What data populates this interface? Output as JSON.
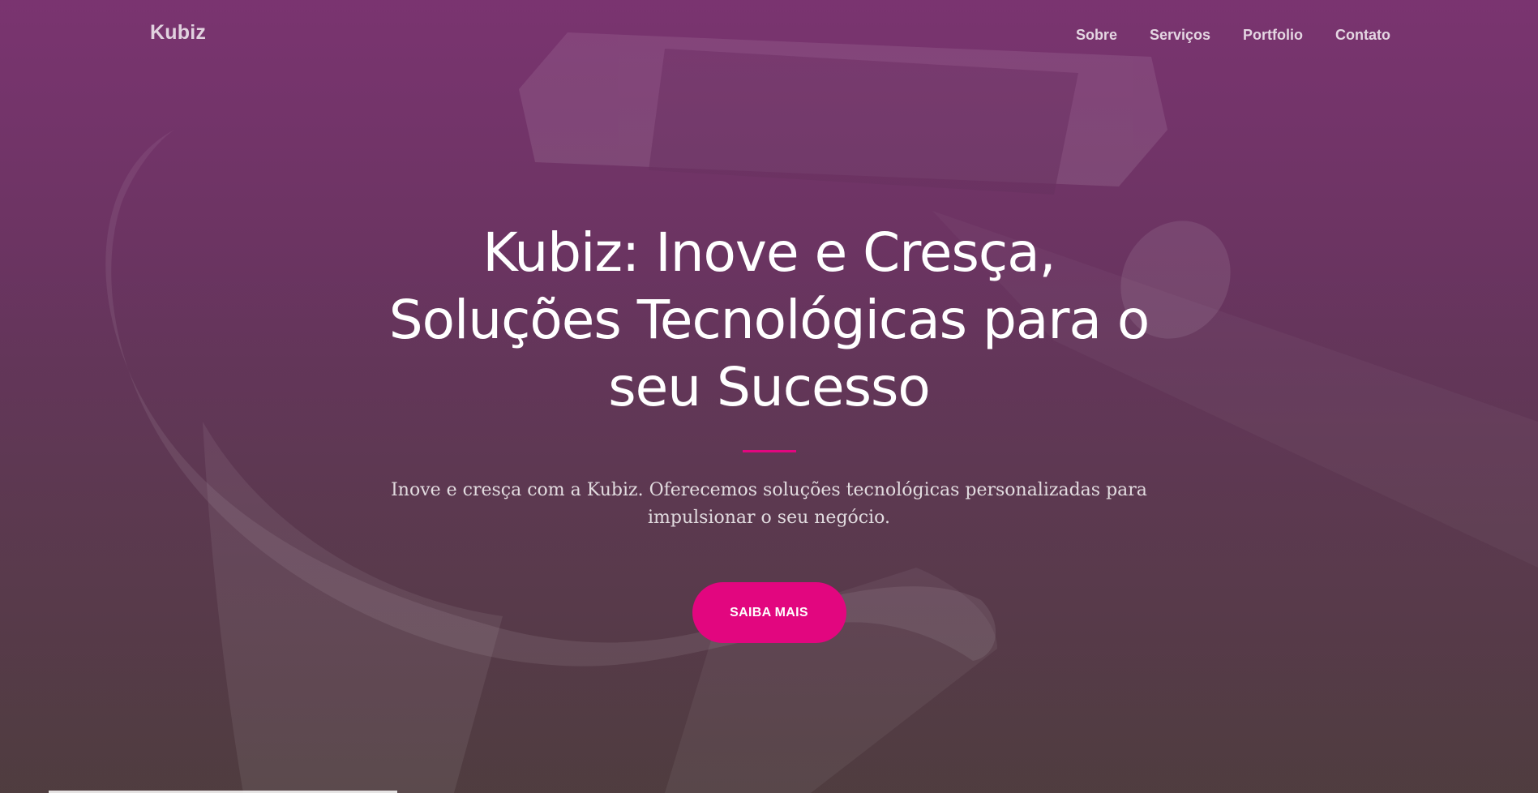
{
  "navbar": {
    "brand": "Kubiz",
    "links": [
      "Sobre",
      "Serviços",
      "Portfolio",
      "Contato"
    ]
  },
  "hero": {
    "title_lines": [
      "Kubiz: Inove e Cresça,",
      "Soluções Tecnológicas para o",
      "seu Sucesso"
    ],
    "subtitle": "Inove e cresça com a Kubiz. Oferecemos soluções tecnológicas personalizadas para impulsionar o seu negócio.",
    "cta_label": "SAIBA MAIS"
  },
  "colors": {
    "accent": "#e2067f",
    "background_top": "#7a3470",
    "background_bottom": "#4f3d3f"
  }
}
